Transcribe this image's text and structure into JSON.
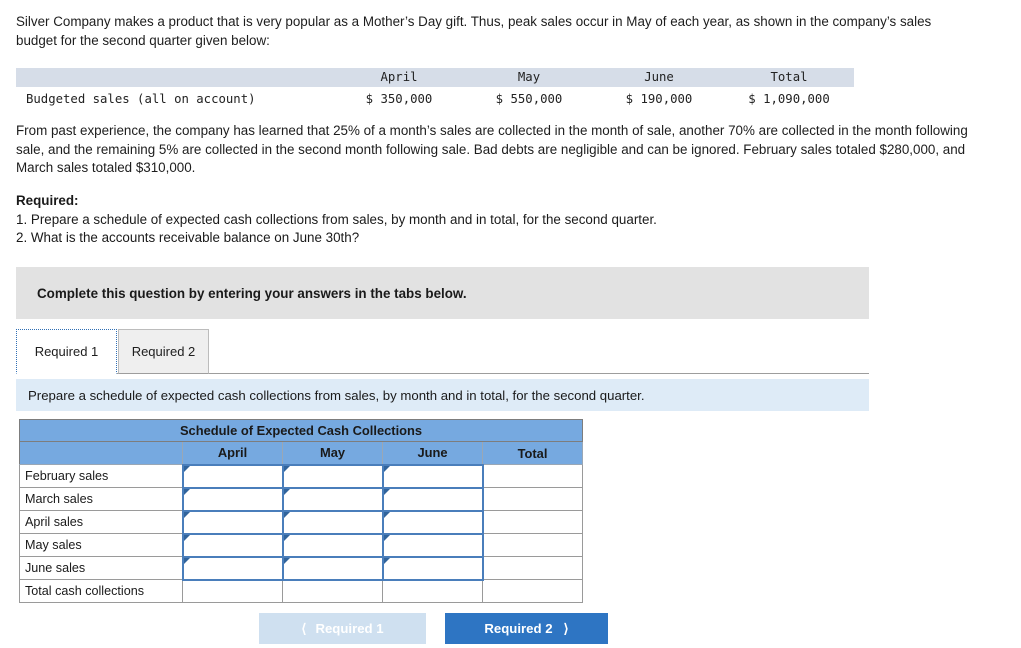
{
  "intro": {
    "paragraph": "Silver Company makes a product that is very popular as a Mother’s Day gift. Thus, peak sales occur in May of each year, as shown in the company’s sales budget for the second quarter given below:"
  },
  "budget_table": {
    "columns": [
      "",
      "April",
      "May",
      "June",
      "Total"
    ],
    "rows": [
      {
        "label": "Budgeted sales (all on account)",
        "april": "$ 350,000",
        "may": "$ 550,000",
        "june": "$ 190,000",
        "total": "$ 1,090,000"
      }
    ]
  },
  "collection_policy": {
    "paragraph": "From past experience, the company has learned that 25% of a month’s sales are collected in the month of sale, another 70% are collected in the month following sale, and the remaining 5% are collected in the second month following sale. Bad debts are negligible and can be ignored. February sales totaled $280,000, and March sales totaled $310,000."
  },
  "required": {
    "heading": "Required:",
    "items": [
      "1. Prepare a schedule of expected cash collections from sales, by month and in total, for the second quarter.",
      "2. What is the accounts receivable balance on June 30th?"
    ]
  },
  "banner": {
    "text": "Complete this question by entering your answers in the tabs below."
  },
  "tabs": [
    {
      "label": "Required 1",
      "active": true
    },
    {
      "label": "Required 2",
      "active": false
    }
  ],
  "prompt": {
    "text": "Prepare a schedule of expected cash collections from sales, by month and in total, for the second quarter."
  },
  "schedule_table": {
    "title": "Schedule of Expected Cash Collections",
    "columns": [
      "",
      "April",
      "May",
      "June",
      "Total"
    ],
    "rows": [
      {
        "label": "February sales",
        "april": "",
        "may": "",
        "june": "",
        "total": "",
        "inputs": true
      },
      {
        "label": "March sales",
        "april": "",
        "may": "",
        "june": "",
        "total": "",
        "inputs": true
      },
      {
        "label": "April sales",
        "april": "",
        "may": "",
        "june": "",
        "total": "",
        "inputs": true
      },
      {
        "label": "May sales",
        "april": "",
        "may": "",
        "june": "",
        "total": "",
        "inputs": true
      },
      {
        "label": "June sales",
        "april": "",
        "may": "",
        "june": "",
        "total": "",
        "inputs": true
      },
      {
        "label": "Total cash collections",
        "april": "",
        "may": "",
        "june": "",
        "total": "",
        "inputs": false
      }
    ]
  },
  "nav": {
    "prev_label": "Required 1",
    "prev_icon": "chevron-left-icon",
    "next_label": "Required 2",
    "next_icon": "chevron-right-icon"
  },
  "colors": {
    "header_blue": "#76a9e0",
    "prompt_blue": "#deebf7",
    "banner_gray": "#e2e2e2",
    "input_border": "#4a7ebb",
    "button_blue": "#2e75c3",
    "button_disabled": "#cfe0f0",
    "budget_header_gray": "#d6dde8"
  }
}
